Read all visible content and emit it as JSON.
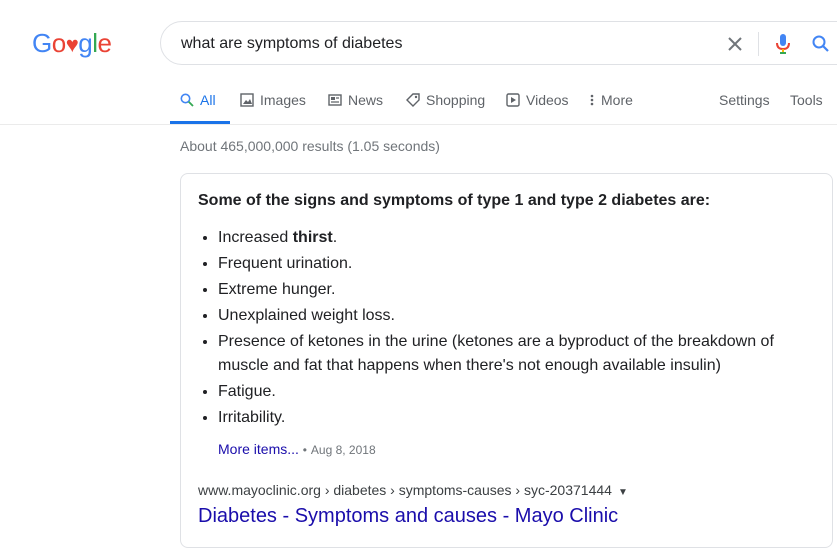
{
  "logo": {
    "g1": "G",
    "o1": "o",
    "heart": "♥",
    "g2": "g",
    "l": "l",
    "e": "e",
    "colors": {
      "blue": "#4285f4",
      "red": "#ea4335",
      "yellow": "#fbbc05",
      "green": "#34a853"
    }
  },
  "search": {
    "query": "what are symptoms of diabetes"
  },
  "nav": {
    "tabs": [
      {
        "label": "All",
        "icon": "search-icon"
      },
      {
        "label": "Images",
        "icon": "image-icon"
      },
      {
        "label": "News",
        "icon": "news-icon"
      },
      {
        "label": "Shopping",
        "icon": "tag-icon"
      },
      {
        "label": "Videos",
        "icon": "play-icon"
      },
      {
        "label": "More",
        "icon": "more-vert-icon"
      }
    ],
    "settings": "Settings",
    "tools": "Tools"
  },
  "stats": "About 465,000,000 results (1.05 seconds)",
  "snippet": {
    "heading": "Some of the signs and symptoms of type 1 and type 2 diabetes are:",
    "items": [
      {
        "pre": "Increased ",
        "bold": "thirst",
        "post": "."
      },
      {
        "text": "Frequent urination."
      },
      {
        "text": "Extreme hunger."
      },
      {
        "text": "Unexplained weight loss."
      },
      {
        "text": "Presence of ketones in the urine (ketones are a byproduct of the breakdown of muscle and fat that happens when there's not enough available insulin)"
      },
      {
        "text": "Fatigue."
      },
      {
        "text": "Irritability."
      }
    ],
    "more_items": "More items...",
    "separator": "•",
    "date": "Aug 8, 2018",
    "cite": "www.mayoclinic.org › diabetes › symptoms-causes › syc-20371444",
    "title": "Diabetes - Symptoms and causes - Mayo Clinic"
  }
}
